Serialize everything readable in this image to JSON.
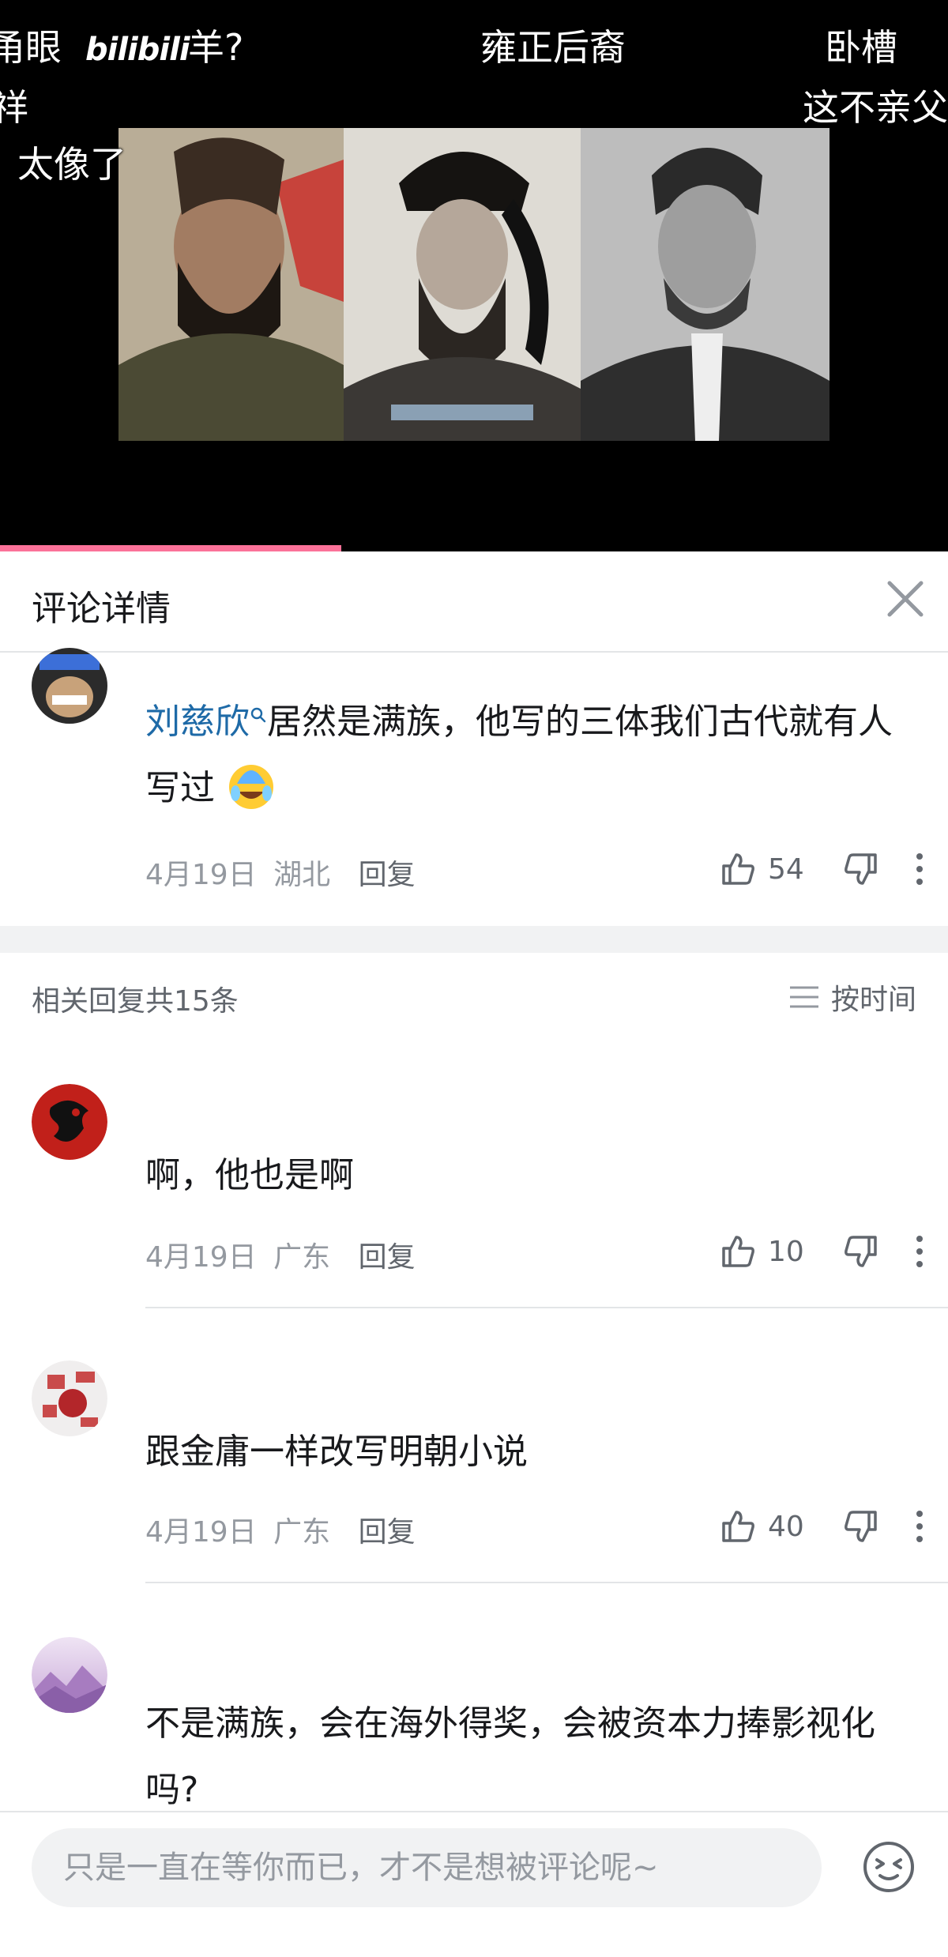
{
  "video": {
    "danmaku": [
      "甬眼",
      "羊?",
      "雍正后裔",
      "卧槽",
      "祥",
      "这不亲父",
      "太像了"
    ],
    "logo": "bilibili",
    "progress": 0.36
  },
  "sheet": {
    "title": "评论详情"
  },
  "main_comment": {
    "mention": "刘慈欣",
    "text": "居然是满族，他写的三体我们古代就有人写过",
    "date": "4月19日",
    "location": "湖北",
    "reply_label": "回复",
    "likes": "54"
  },
  "replies": {
    "count_label": "相关回复共15条",
    "sort_label": "按时间",
    "items": [
      {
        "text": "啊，他也是啊",
        "date": "4月19日",
        "location": "广东",
        "reply_label": "回复",
        "likes": "10"
      },
      {
        "text": "跟金庸一样改写明朝小说",
        "date": "4月19日",
        "location": "广东",
        "reply_label": "回复",
        "likes": "40"
      },
      {
        "text": "不是满族，会在海外得奖，会被资本力捧影视化吗?"
      }
    ]
  },
  "input": {
    "placeholder": "只是一直在等你而已，才不是想被评论呢~"
  },
  "colors": {
    "accent_pink": "#fb7299",
    "mention_blue": "#1e6aa7",
    "meta_gray": "#9499a0"
  }
}
